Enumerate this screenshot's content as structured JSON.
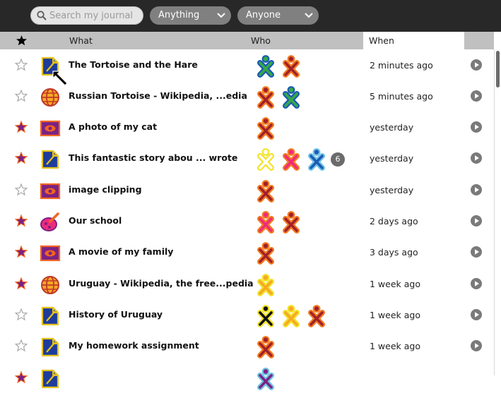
{
  "toolbar": {
    "search_placeholder": "Search my journal",
    "filter_what": "Anything",
    "filter_who": "Anyone"
  },
  "header": {
    "star_icon": "star-icon",
    "what": "What",
    "who": "Who",
    "when": "When"
  },
  "colors": {
    "toolbar": "#282828",
    "header": "#c0c0c0",
    "star_filled": "#7b2283",
    "star_fill_orange": "#f26522"
  },
  "rows": [
    {
      "starred": false,
      "icon": "text-document-icon",
      "title": "The Tortoise and the Hare",
      "when": "2 minutes ago"
    },
    {
      "starred": false,
      "icon": "web-globe-icon",
      "title": "Russian Tortoise - Wikipedia, ...edia",
      "when": "5 minutes ago"
    },
    {
      "starred": true,
      "icon": "image-viewer-icon",
      "title": "A photo of my cat",
      "when": "yesterday"
    },
    {
      "starred": true,
      "icon": "text-document-icon",
      "title": "This fantastic story abou ... wrote",
      "when": "yesterday",
      "more_count": "6"
    },
    {
      "starred": false,
      "icon": "image-viewer-icon",
      "title": "image clipping",
      "when": "yesterday"
    },
    {
      "starred": true,
      "icon": "paint-icon",
      "title": "Our school",
      "when": "2 days ago"
    },
    {
      "starred": true,
      "icon": "image-viewer-icon",
      "title": "A movie of my family",
      "when": "3 days ago"
    },
    {
      "starred": true,
      "icon": "web-globe-icon",
      "title": "Uruguay - Wikipedia, the free...pedia",
      "when": "1 week ago"
    },
    {
      "starred": false,
      "icon": "text-document-icon",
      "title": "History of Uruguay",
      "when": "1 week ago"
    },
    {
      "starred": false,
      "icon": "text-document-icon",
      "title": "My homework assignment",
      "when": "1 week ago"
    },
    {
      "starred": true,
      "icon": "text-document-icon",
      "title": "",
      "when": ""
    }
  ]
}
